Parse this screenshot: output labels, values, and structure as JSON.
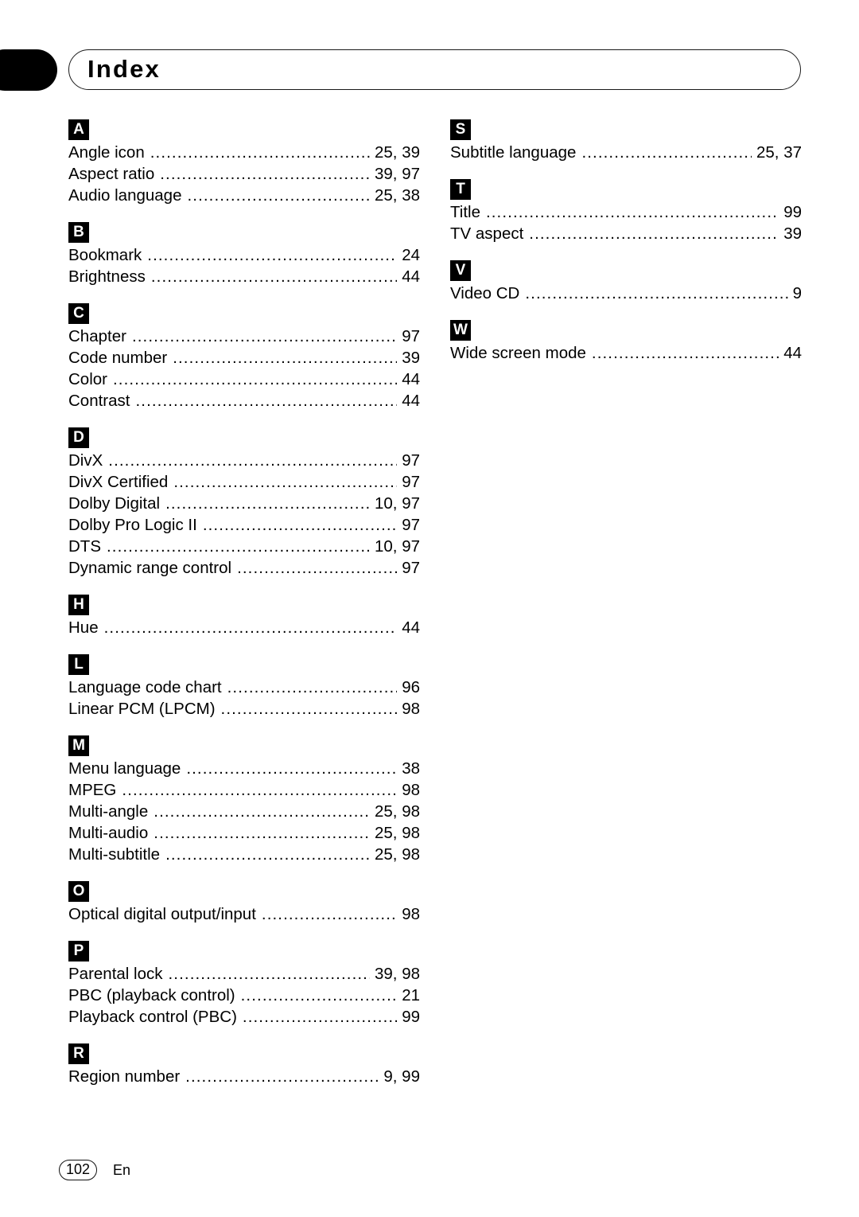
{
  "header": {
    "title": "Index",
    "tab_icon": "black-tab-marker"
  },
  "columns": [
    {
      "id": "left",
      "sections": [
        {
          "letter": "A",
          "entries": [
            {
              "term": "Angle icon",
              "pages": "25, 39"
            },
            {
              "term": "Aspect ratio",
              "pages": "39, 97"
            },
            {
              "term": "Audio language",
              "pages": "25, 38"
            }
          ]
        },
        {
          "letter": "B",
          "entries": [
            {
              "term": "Bookmark",
              "pages": "24"
            },
            {
              "term": "Brightness",
              "pages": "44"
            }
          ]
        },
        {
          "letter": "C",
          "entries": [
            {
              "term": "Chapter",
              "pages": "97"
            },
            {
              "term": "Code number",
              "pages": "39"
            },
            {
              "term": "Color",
              "pages": "44"
            },
            {
              "term": "Contrast",
              "pages": "44"
            }
          ]
        },
        {
          "letter": "D",
          "entries": [
            {
              "term": "DivX",
              "pages": "97"
            },
            {
              "term": "DivX Certified",
              "pages": "97"
            },
            {
              "term": "Dolby Digital",
              "pages": "10, 97"
            },
            {
              "term": "Dolby Pro Logic II",
              "pages": "97"
            },
            {
              "term": "DTS",
              "pages": "10, 97"
            },
            {
              "term": "Dynamic range control",
              "pages": "97"
            }
          ]
        },
        {
          "letter": "H",
          "entries": [
            {
              "term": "Hue",
              "pages": "44"
            }
          ]
        },
        {
          "letter": "L",
          "entries": [
            {
              "term": "Language code chart",
              "pages": "96"
            },
            {
              "term": "Linear PCM (LPCM)",
              "pages": "98"
            }
          ]
        },
        {
          "letter": "M",
          "entries": [
            {
              "term": "Menu language",
              "pages": "38"
            },
            {
              "term": "MPEG",
              "pages": "98"
            },
            {
              "term": "Multi-angle",
              "pages": "25, 98"
            },
            {
              "term": "Multi-audio",
              "pages": "25, 98"
            },
            {
              "term": "Multi-subtitle",
              "pages": "25, 98"
            }
          ]
        },
        {
          "letter": "O",
          "entries": [
            {
              "term": "Optical digital output/input",
              "pages": "98"
            }
          ]
        },
        {
          "letter": "P",
          "entries": [
            {
              "term": "Parental lock",
              "pages": "39, 98"
            },
            {
              "term": "PBC (playback control)",
              "pages": "21"
            },
            {
              "term": "Playback control (PBC)",
              "pages": "99"
            }
          ]
        },
        {
          "letter": "R",
          "entries": [
            {
              "term": "Region number",
              "pages": "9, 99"
            }
          ]
        }
      ]
    },
    {
      "id": "right",
      "sections": [
        {
          "letter": "S",
          "entries": [
            {
              "term": "Subtitle language",
              "pages": "25, 37"
            }
          ]
        },
        {
          "letter": "T",
          "entries": [
            {
              "term": "Title",
              "pages": "99"
            },
            {
              "term": "TV aspect",
              "pages": "39"
            }
          ]
        },
        {
          "letter": "V",
          "entries": [
            {
              "term": "Video CD",
              "pages": "9"
            }
          ]
        },
        {
          "letter": "W",
          "entries": [
            {
              "term": "Wide screen mode",
              "pages": "44"
            }
          ]
        }
      ]
    }
  ],
  "footer": {
    "page_number": "102",
    "language": "En"
  }
}
